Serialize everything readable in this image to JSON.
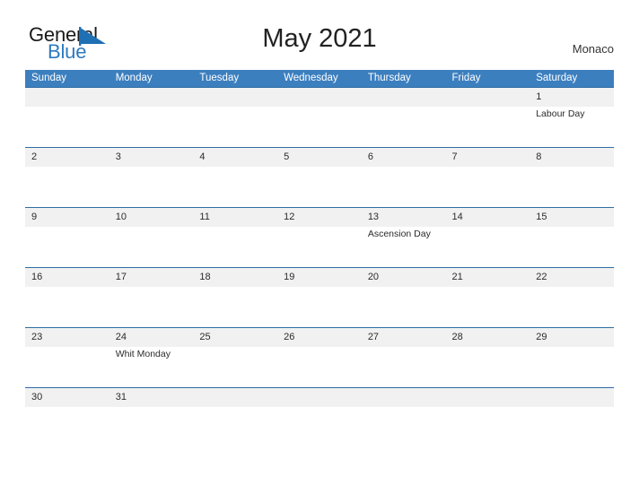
{
  "brand": {
    "word_one": "General",
    "word_two": "Blue",
    "flag_icon": "blue-triangle-flag-icon",
    "accent_color": "#2E7AC0"
  },
  "header": {
    "title": "May 2021",
    "country": "Monaco"
  },
  "colors": {
    "header_bar": "#3C7FBF",
    "row_divider": "#2E6DA4",
    "date_band": "#F1F1F1",
    "text": "#2b2b2b"
  },
  "calendar": {
    "month": "May",
    "year": "2021",
    "weekday_headers": [
      "Sunday",
      "Monday",
      "Tuesday",
      "Wednesday",
      "Thursday",
      "Friday",
      "Saturday"
    ],
    "weeks": [
      [
        {
          "date": "",
          "event": ""
        },
        {
          "date": "",
          "event": ""
        },
        {
          "date": "",
          "event": ""
        },
        {
          "date": "",
          "event": ""
        },
        {
          "date": "",
          "event": ""
        },
        {
          "date": "",
          "event": ""
        },
        {
          "date": "1",
          "event": "Labour Day"
        }
      ],
      [
        {
          "date": "2",
          "event": ""
        },
        {
          "date": "3",
          "event": ""
        },
        {
          "date": "4",
          "event": ""
        },
        {
          "date": "5",
          "event": ""
        },
        {
          "date": "6",
          "event": ""
        },
        {
          "date": "7",
          "event": ""
        },
        {
          "date": "8",
          "event": ""
        }
      ],
      [
        {
          "date": "9",
          "event": ""
        },
        {
          "date": "10",
          "event": ""
        },
        {
          "date": "11",
          "event": ""
        },
        {
          "date": "12",
          "event": ""
        },
        {
          "date": "13",
          "event": "Ascension Day"
        },
        {
          "date": "14",
          "event": ""
        },
        {
          "date": "15",
          "event": ""
        }
      ],
      [
        {
          "date": "16",
          "event": ""
        },
        {
          "date": "17",
          "event": ""
        },
        {
          "date": "18",
          "event": ""
        },
        {
          "date": "19",
          "event": ""
        },
        {
          "date": "20",
          "event": ""
        },
        {
          "date": "21",
          "event": ""
        },
        {
          "date": "22",
          "event": ""
        }
      ],
      [
        {
          "date": "23",
          "event": ""
        },
        {
          "date": "24",
          "event": "Whit Monday"
        },
        {
          "date": "25",
          "event": ""
        },
        {
          "date": "26",
          "event": ""
        },
        {
          "date": "27",
          "event": ""
        },
        {
          "date": "28",
          "event": ""
        },
        {
          "date": "29",
          "event": ""
        }
      ],
      [
        {
          "date": "30",
          "event": ""
        },
        {
          "date": "31",
          "event": ""
        },
        {
          "date": "",
          "event": ""
        },
        {
          "date": "",
          "event": ""
        },
        {
          "date": "",
          "event": ""
        },
        {
          "date": "",
          "event": ""
        },
        {
          "date": "",
          "event": ""
        }
      ]
    ],
    "holidays": [
      {
        "date": "1",
        "name": "Labour Day"
      },
      {
        "date": "13",
        "name": "Ascension Day"
      },
      {
        "date": "24",
        "name": "Whit Monday"
      }
    ]
  }
}
